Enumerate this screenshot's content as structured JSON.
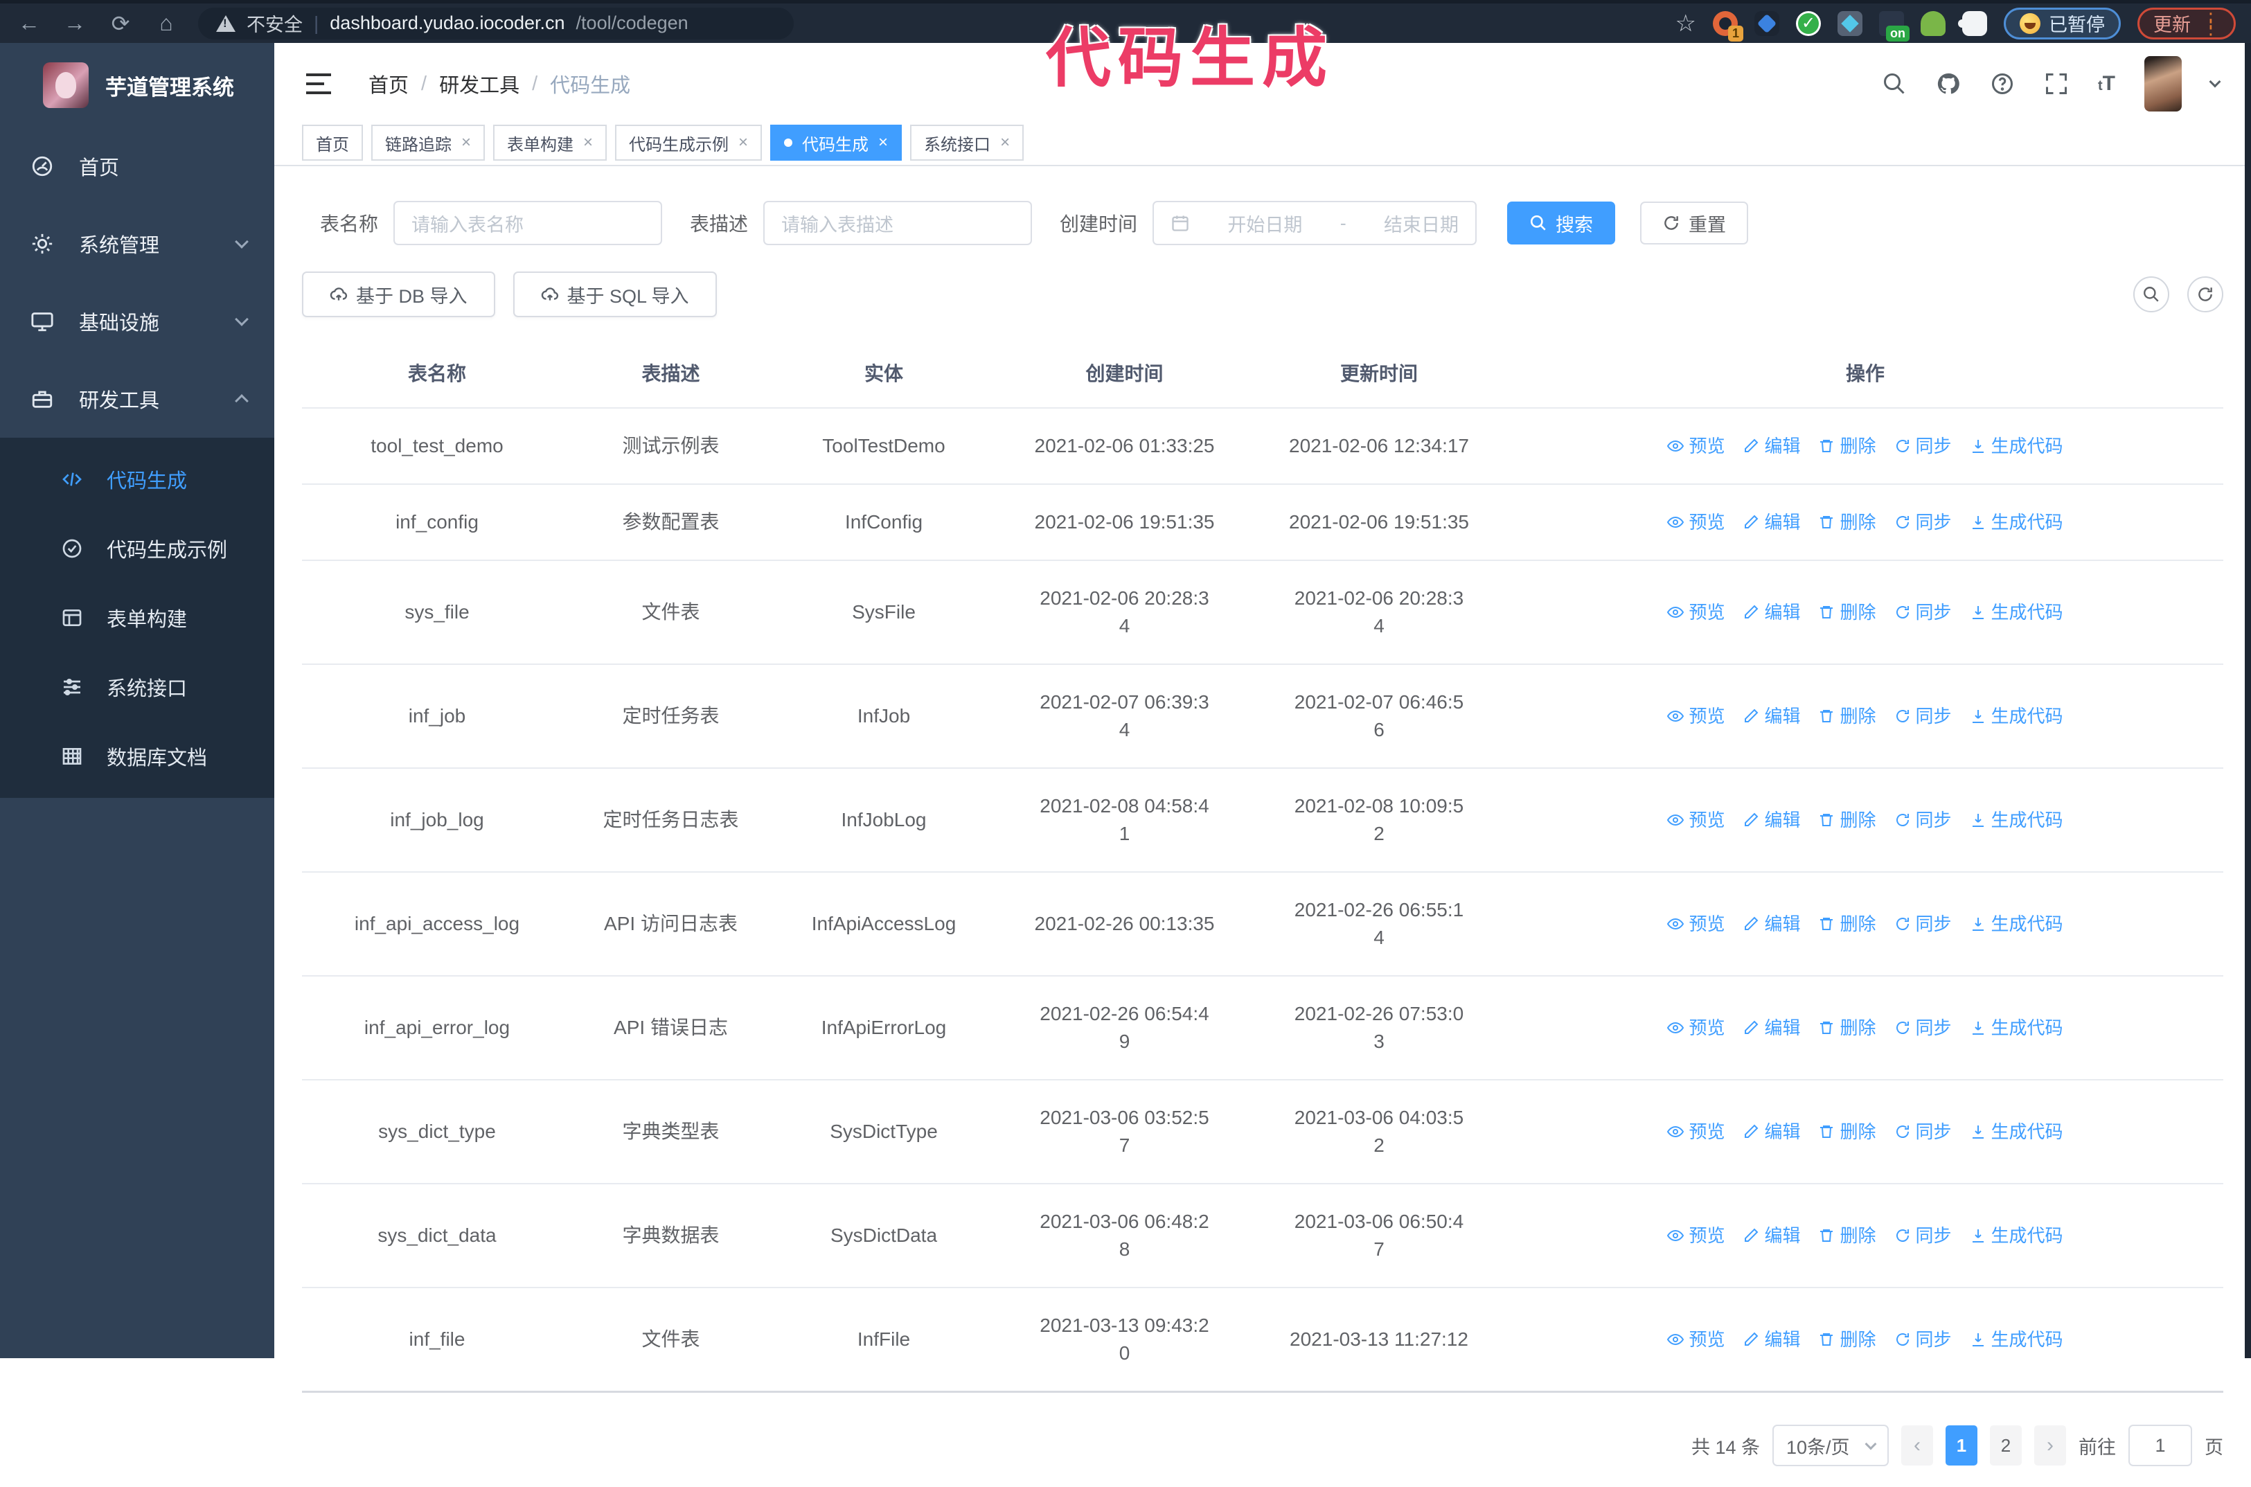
{
  "colors": {
    "accent": "#409eff",
    "sidebar_bg": "#304156",
    "submenu_bg": "#1f2d3d",
    "chrome_bg": "#202a38",
    "annotation": "#ec3c66"
  },
  "browser": {
    "security_warning": "不安全",
    "url_host": "dashboard.yudao.iocoder.cn",
    "url_path": "/tool/codegen",
    "ext_badge_count": "1",
    "ext_badge_on": "on",
    "paused_badge": "已暂停",
    "update_button": "更新"
  },
  "annotation": {
    "text": "代码生成"
  },
  "sidebar": {
    "logo_title": "芋道管理系统",
    "items": [
      {
        "label": "首页"
      },
      {
        "label": "系统管理"
      },
      {
        "label": "基础设施"
      },
      {
        "label": "研发工具"
      }
    ],
    "submenu": [
      {
        "label": "代码生成"
      },
      {
        "label": "代码生成示例"
      },
      {
        "label": "表单构建"
      },
      {
        "label": "系统接口"
      },
      {
        "label": "数据库文档"
      }
    ]
  },
  "header": {
    "breadcrumb": [
      "首页",
      "研发工具",
      "代码生成"
    ]
  },
  "tabs": [
    {
      "label": "首页"
    },
    {
      "label": "链路追踪"
    },
    {
      "label": "表单构建"
    },
    {
      "label": "代码生成示例"
    },
    {
      "label": "代码生成"
    },
    {
      "label": "系统接口"
    }
  ],
  "filters": {
    "table_name_label": "表名称",
    "table_name_placeholder": "请输入表名称",
    "table_desc_label": "表描述",
    "table_desc_placeholder": "请输入表描述",
    "create_time_label": "创建时间",
    "date_start_placeholder": "开始日期",
    "date_separator": "-",
    "date_end_placeholder": "结束日期",
    "search_label": "搜索",
    "reset_label": "重置"
  },
  "toolbar": {
    "import_db": "基于 DB 导入",
    "import_sql": "基于 SQL 导入"
  },
  "table": {
    "columns": [
      "表名称",
      "表描述",
      "实体",
      "创建时间",
      "更新时间",
      "操作"
    ],
    "actions": [
      "预览",
      "编辑",
      "删除",
      "同步",
      "生成代码"
    ],
    "rows": [
      {
        "name": "tool_test_demo",
        "desc": "测试示例表",
        "entity": "ToolTestDemo",
        "created": "2021-02-06 01:33:25",
        "updated": "2021-02-06 12:34:17",
        "created_two_line": false,
        "updated_two_line": false
      },
      {
        "name": "inf_config",
        "desc": "参数配置表",
        "entity": "InfConfig",
        "created": "2021-02-06 19:51:35",
        "updated": "2021-02-06 19:51:35",
        "created_two_line": false,
        "updated_two_line": false
      },
      {
        "name": "sys_file",
        "desc": "文件表",
        "entity": "SysFile",
        "created": "2021-02-06 20:28:34",
        "updated": "2021-02-06 20:28:34",
        "created_two_line": true,
        "updated_two_line": true
      },
      {
        "name": "inf_job",
        "desc": "定时任务表",
        "entity": "InfJob",
        "created": "2021-02-07 06:39:34",
        "updated": "2021-02-07 06:46:56",
        "created_two_line": true,
        "updated_two_line": true
      },
      {
        "name": "inf_job_log",
        "desc": "定时任务日志表",
        "entity": "InfJobLog",
        "created": "2021-02-08 04:58:41",
        "updated": "2021-02-08 10:09:52",
        "created_two_line": true,
        "updated_two_line": true
      },
      {
        "name": "inf_api_access_log",
        "desc": "API 访问日志表",
        "entity": "InfApiAccessLog",
        "created": "2021-02-26 00:13:35",
        "updated": "2021-02-26 06:55:14",
        "created_two_line": false,
        "updated_two_line": true
      },
      {
        "name": "inf_api_error_log",
        "desc": "API 错误日志",
        "entity": "InfApiErrorLog",
        "created": "2021-02-26 06:54:49",
        "updated": "2021-02-26 07:53:03",
        "created_two_line": true,
        "updated_two_line": true
      },
      {
        "name": "sys_dict_type",
        "desc": "字典类型表",
        "entity": "SysDictType",
        "created": "2021-03-06 03:52:57",
        "updated": "2021-03-06 04:03:52",
        "created_two_line": true,
        "updated_two_line": true
      },
      {
        "name": "sys_dict_data",
        "desc": "字典数据表",
        "entity": "SysDictData",
        "created": "2021-03-06 06:48:28",
        "updated": "2021-03-06 06:50:47",
        "created_two_line": true,
        "updated_two_line": true
      },
      {
        "name": "inf_file",
        "desc": "文件表",
        "entity": "InfFile",
        "created": "2021-03-13 09:43:20",
        "updated": "2021-03-13 11:27:12",
        "created_two_line": true,
        "updated_two_line": false
      }
    ]
  },
  "pagination": {
    "total": "共 14 条",
    "page_size": "10条/页",
    "pages": [
      "1",
      "2"
    ],
    "active_page": "1",
    "goto_label": "前往",
    "goto_value": "1",
    "goto_suffix": "页"
  }
}
